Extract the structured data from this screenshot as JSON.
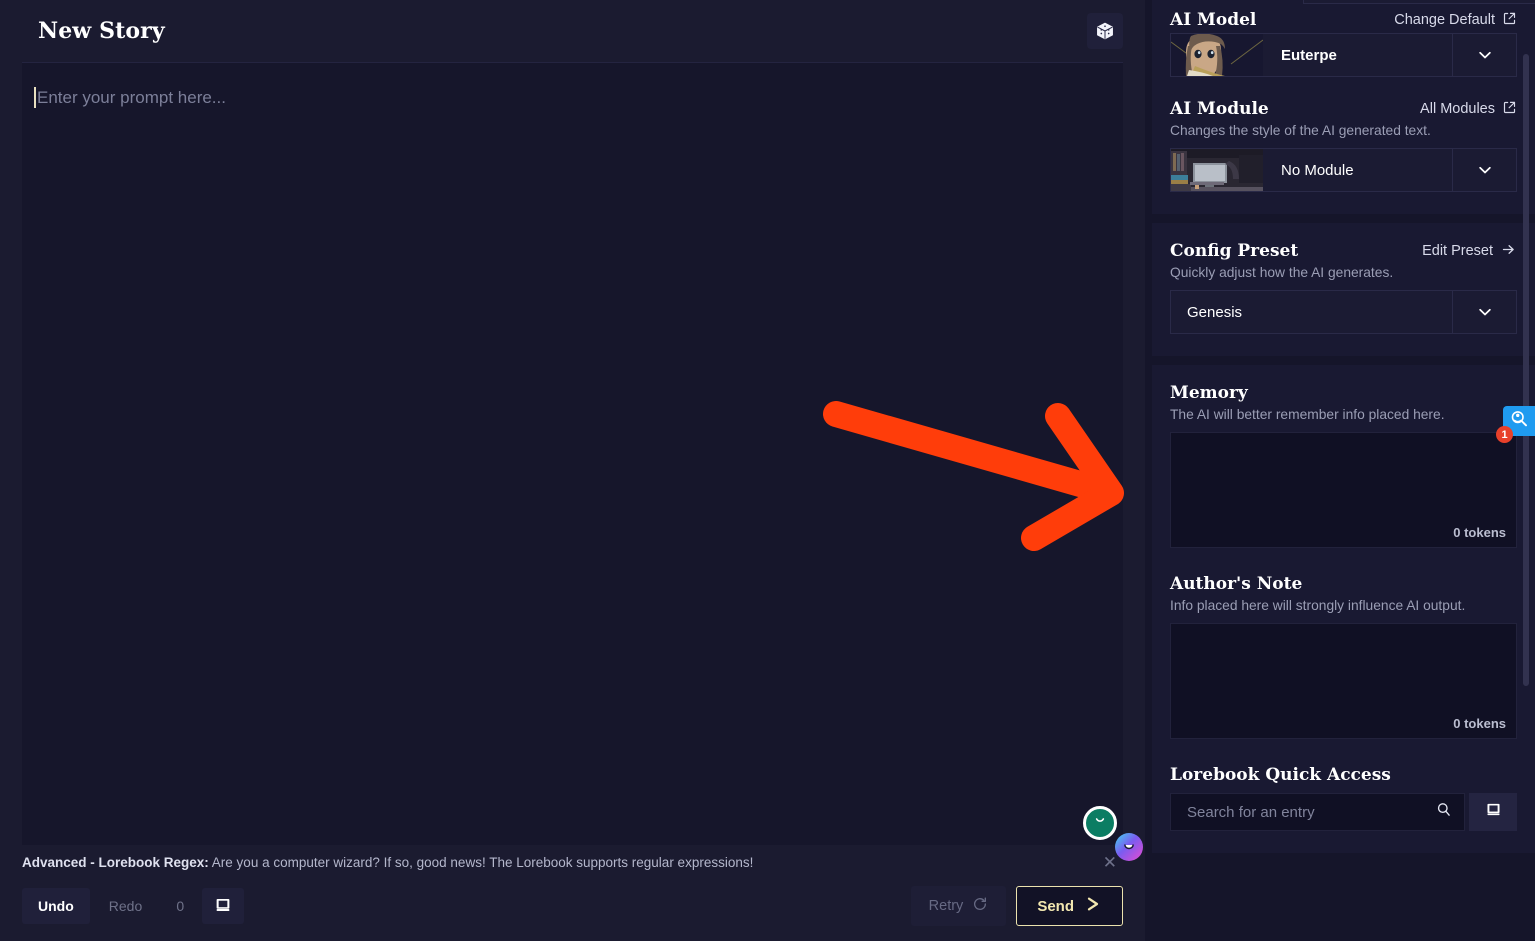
{
  "editor": {
    "story_title": "New Story",
    "dice_icon": "dice-icon",
    "prompt_placeholder": "Enter your prompt here...",
    "tip": {
      "label": "Advanced - Lorebook Regex:",
      "text": " Are you a computer wizard? If so, good news! The Lorebook supports regular expressions!",
      "close_icon": "close-icon"
    },
    "toolbar": {
      "undo_label": "Undo",
      "redo_label": "Redo",
      "step_count": "0",
      "lorebook_icon": "book-icon",
      "retry_label": "Retry",
      "retry_icon": "refresh-icon",
      "send_label": "Send",
      "send_icon": "send-arrow-icon"
    },
    "annotation": {
      "arrow_color": "#FF3D0A",
      "arrow_icon": "red-arrow-pointing-right"
    },
    "avatars": {
      "green_icon": "smiling-face-avatar",
      "blob_icon": "gradient-blob-avatar"
    }
  },
  "sidebar": {
    "ai_model": {
      "title": "AI Model",
      "link_label": "Change Default",
      "link_icon": "external-link-icon",
      "selected": "Euterpe",
      "thumbnail": "anime-portrait-thumbnail",
      "chevron_icon": "chevron-down-icon"
    },
    "ai_module": {
      "title": "AI Module",
      "link_label": "All Modules",
      "link_icon": "external-link-icon",
      "description": "Changes the style of the AI generated text.",
      "selected": "No Module",
      "thumbnail": "desk-room-thumbnail",
      "chevron_icon": "chevron-down-icon"
    },
    "config_preset": {
      "title": "Config Preset",
      "link_label": "Edit Preset",
      "link_icon": "arrow-right-icon",
      "description": "Quickly adjust how the AI generates.",
      "selected": "Genesis",
      "chevron_icon": "chevron-down-icon"
    },
    "memory": {
      "title": "Memory",
      "description": "The AI will better remember info placed here.",
      "value": "",
      "token_count": "0 tokens"
    },
    "authors_note": {
      "title": "Author's Note",
      "description": "Info placed here will strongly influence AI output.",
      "value": "",
      "token_count": "0 tokens"
    },
    "lorebook": {
      "title": "Lorebook Quick Access",
      "search_placeholder": "Search for an entry",
      "search_value": "",
      "search_icon": "search-icon",
      "add_icon": "book-icon"
    },
    "float_tab": {
      "icon": "lorebook-search-icon",
      "badge": "1",
      "color": "#1F9BF0",
      "badge_color": "#E8402A"
    }
  }
}
